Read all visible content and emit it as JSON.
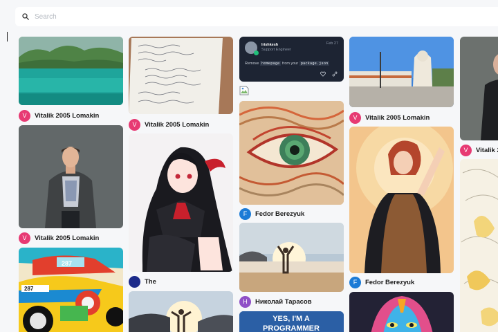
{
  "search": {
    "placeholder": "Search",
    "value": ""
  },
  "pins": [
    {
      "author": "Vitalik 2005 Lomakin",
      "initial": "V",
      "color": "#e73a73",
      "alt": "Turquoise lake with forested hills"
    },
    {
      "author": "Vitalik 2005 Lomakin",
      "initial": "V",
      "color": "#e73a73",
      "alt": "Man in checked shirt against grey wall"
    },
    {
      "author": "",
      "initial": "",
      "color": "",
      "alt": "Colorful pop-art cars"
    },
    {
      "author": "Vitalik 2005 Lomakin",
      "initial": "V",
      "color": "#e73a73",
      "alt": "Handwritten notebook page"
    },
    {
      "author": "The",
      "initial": "",
      "color": "#1b2a8a",
      "alt": "Anime girl with black hair and red ribbon"
    },
    {
      "author": "",
      "initial": "",
      "color": "",
      "alt": "Person raising arms at sunrise"
    },
    {
      "tweet": {
        "handle": "Irishkesh",
        "role": "Support Engineer",
        "date": "Feb 27",
        "message_prefix": "Remove",
        "code1": "homepage",
        "message_mid": "from your",
        "code2": "package.json"
      }
    },
    {
      "author": "Fedor Berezyuk",
      "initial": "F",
      "color": "#1c7bd6",
      "alt": "Painted eye close-up"
    },
    {
      "author": "Николай Тарасов",
      "initial": "H",
      "color": "#8f4fc7",
      "alt": "Person on beach at sunset"
    },
    {
      "author": "",
      "initial": "",
      "color": "",
      "banner_line1": "YES, I'M A",
      "banner_line2": "PROGRAMMER"
    },
    {
      "author": "Vitalik 2005 Lomakin",
      "initial": "V",
      "color": "#e73a73",
      "alt": "Building with tower under blue sky"
    },
    {
      "author": "Fedor Berezyuk",
      "initial": "F",
      "color": "#1c7bd6",
      "alt": "Redhead woman in brown dress with halo"
    },
    {
      "author": "",
      "initial": "",
      "color": "",
      "alt": "Colorful painted face"
    },
    {
      "author": "Vitalik 2",
      "initial": "V",
      "color": "#e73a73",
      "alt": "Man in dark coat"
    },
    {
      "author": "",
      "initial": "",
      "color": "",
      "alt": "Sketch illustration with yellow accents"
    }
  ]
}
